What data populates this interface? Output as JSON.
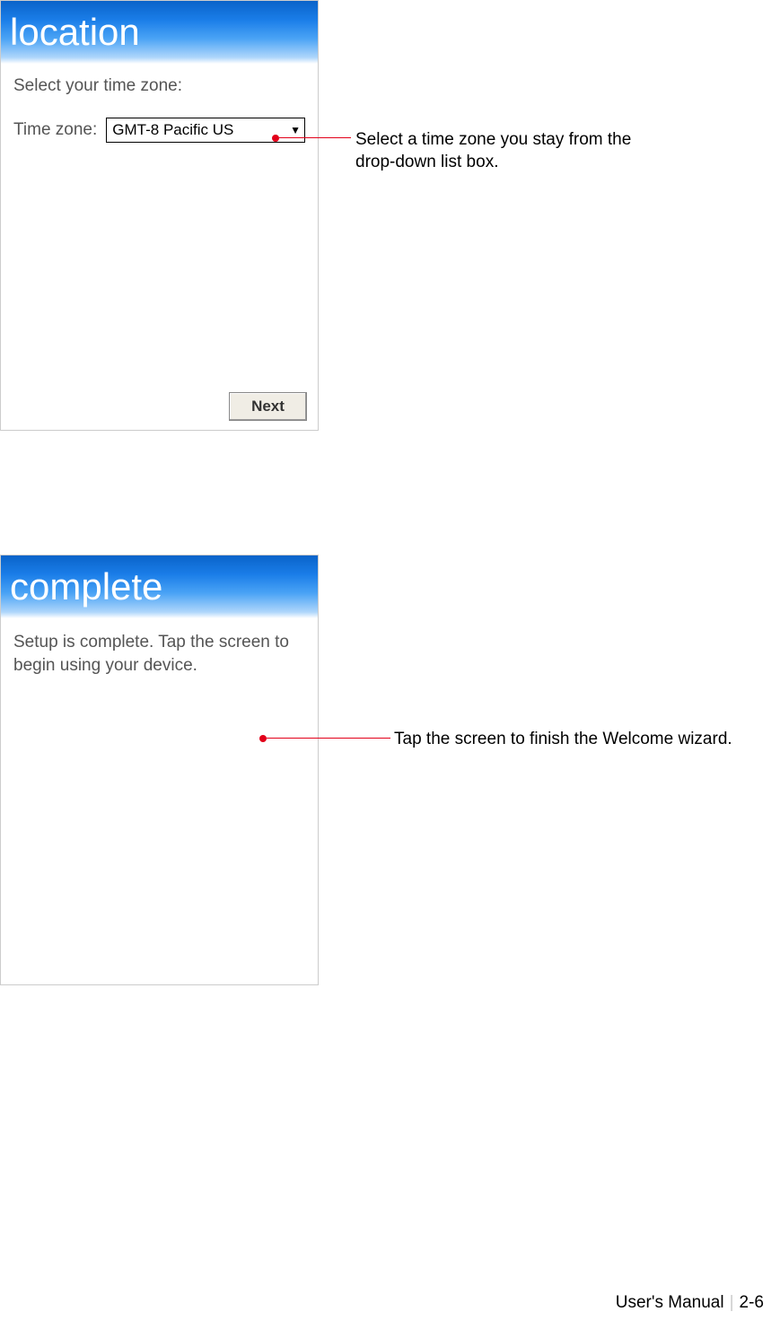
{
  "screens": {
    "location": {
      "title": "location",
      "prompt": "Select your time zone:",
      "field_label": "Time zone:",
      "field_value": "GMT-8 Pacific US",
      "next_button": "Next"
    },
    "complete": {
      "title": "complete",
      "body": "Setup is complete. Tap the screen to begin using your device."
    }
  },
  "callouts": {
    "timezone": "Select a time zone you stay from the drop-down list box.",
    "finish": "Tap the screen to finish the Welcome wizard."
  },
  "footer": {
    "left": "User's Manual",
    "sep": "|",
    "right": "2-6"
  }
}
